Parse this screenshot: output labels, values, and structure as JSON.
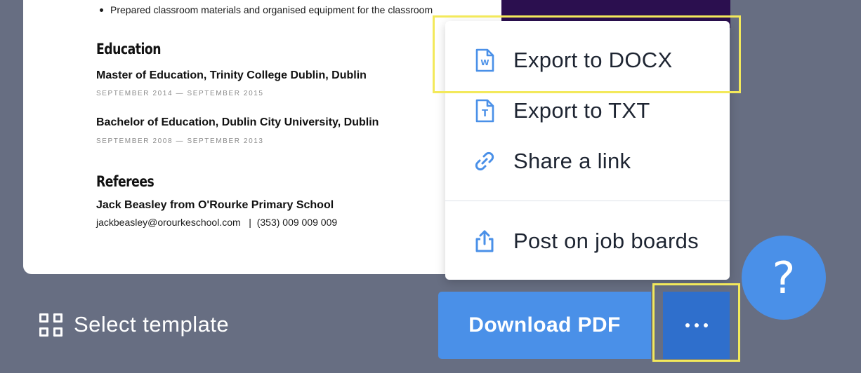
{
  "resume": {
    "bullet": "Prepared classroom materials and organised equipment for the classroom",
    "education": {
      "heading": "Education",
      "entries": [
        {
          "title": "Master of Education, Trinity College Dublin, Dublin",
          "dates": "SEPTEMBER 2014 — SEPTEMBER 2015"
        },
        {
          "title": "Bachelor of Education, Dublin City University, Dublin",
          "dates": "SEPTEMBER 2008 — SEPTEMBER 2013"
        }
      ]
    },
    "referees": {
      "heading": "Referees",
      "name": "Jack Beasley from O'Rourke Primary School",
      "contact": "jackbeasley@orourkeschool.com   |  (353) 009 009 009"
    }
  },
  "menu": {
    "items": [
      {
        "label": "Export to DOCX",
        "icon": "docx-file-icon"
      },
      {
        "label": "Export to TXT",
        "icon": "txt-file-icon"
      },
      {
        "label": "Share a link",
        "icon": "link-icon"
      },
      {
        "label": "Post on job boards",
        "icon": "upload-share-icon"
      }
    ]
  },
  "toolbar": {
    "select_template": "Select template",
    "download_pdf": "Download PDF",
    "more": "more-options-icon",
    "help": "?"
  },
  "colors": {
    "background": "#676e82",
    "accent_blue": "#4a90e8",
    "accent_dark_blue": "#2f6fcc",
    "highlight": "#f3e95b",
    "resume_accent": "#2b0f4f"
  }
}
